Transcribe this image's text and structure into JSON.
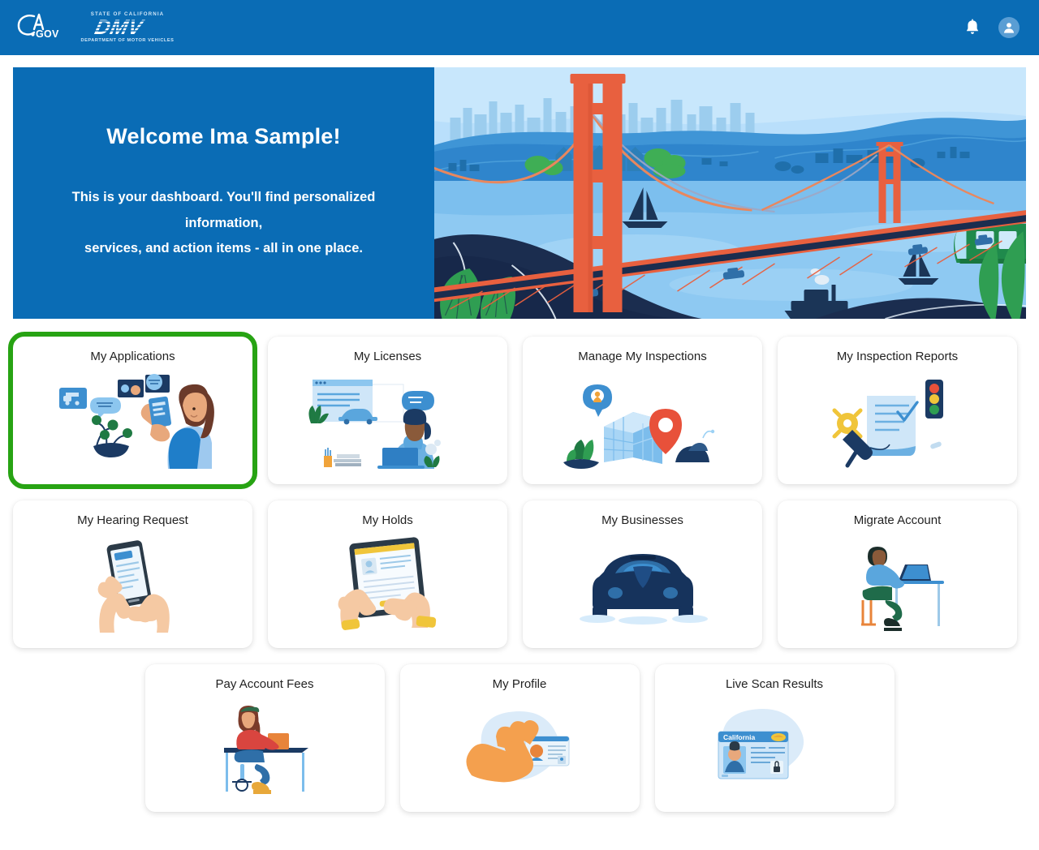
{
  "header": {
    "ca_gov_logo_text": "CA.GOV",
    "dmv_logo": {
      "top_line": "STATE OF CALIFORNIA",
      "acronym": "DMV",
      "bottom_line": "DEPARTMENT OF MOTOR VEHICLES"
    },
    "notification_icon": "bell-icon",
    "account_icon": "user-avatar-icon",
    "background_color": "#0a6cb5"
  },
  "hero": {
    "title": "Welcome Ima Sample!",
    "subtitle_line_1": "This is your dashboard. You'll find personalized information,",
    "subtitle_line_2": "services, and action items - all in one place.",
    "panel_color": "#0a6cb5",
    "illustration": "golden-gate-bridge-illustration"
  },
  "dashboard": {
    "focus_color": "#27a313",
    "rows": [
      {
        "cards": [
          {
            "label": "My Applications",
            "icon": "woman-with-phone-apps-illustration",
            "focused": true
          },
          {
            "label": "My Licenses",
            "icon": "person-at-laptop-browser-illustration",
            "focused": false
          },
          {
            "label": "Manage My Inspections",
            "icon": "map-location-pin-illustration",
            "focused": false
          },
          {
            "label": "My Inspection Reports",
            "icon": "checklist-document-keys-illustration",
            "focused": false
          }
        ]
      },
      {
        "cards": [
          {
            "label": "My Hearing Request",
            "icon": "hands-holding-phone-illustration",
            "focused": false
          },
          {
            "label": "My Holds",
            "icon": "hands-holding-tablet-illustration",
            "focused": false
          },
          {
            "label": "My Businesses",
            "icon": "car-front-illustration",
            "focused": false
          },
          {
            "label": "Migrate Account",
            "icon": "person-at-desk-laptop-illustration",
            "focused": false
          }
        ]
      },
      {
        "centered": true,
        "cards": [
          {
            "label": "Pay Account Fees",
            "icon": "woman-at-desk-paying-illustration",
            "focused": false
          },
          {
            "label": "My Profile",
            "icon": "hand-holding-id-card-illustration",
            "focused": false
          },
          {
            "label": "Live Scan Results",
            "icon": "california-id-card-illustration",
            "focused": false
          }
        ]
      }
    ]
  }
}
